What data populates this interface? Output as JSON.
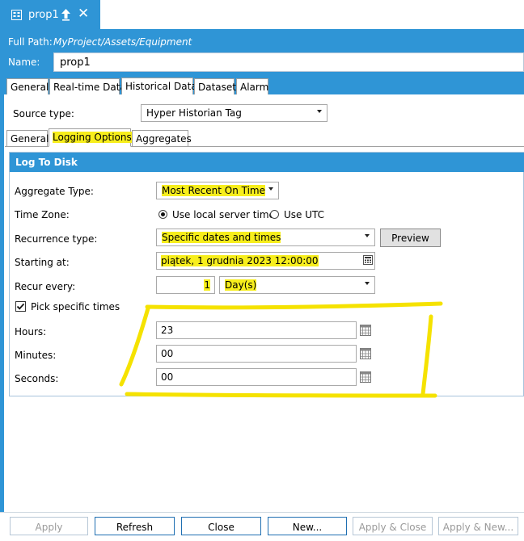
{
  "tab": {
    "title": "prop1"
  },
  "header": {
    "full_path_label": "Full Path:",
    "full_path_value": "MyProject/Assets/Equipment",
    "name_label": "Name:",
    "name_value": "prop1"
  },
  "main_tabs": [
    "General",
    "Real-time Data",
    "Historical Data",
    "Dataset",
    "Alarm"
  ],
  "source_type": {
    "label": "Source type:",
    "value": "Hyper Historian Tag"
  },
  "sub_tabs": [
    "General",
    "Logging Options",
    "Aggregates"
  ],
  "group": {
    "title": "Log To Disk",
    "aggregate_type": {
      "label": "Aggregate Type:",
      "value": "Most Recent On Time"
    },
    "time_zone": {
      "label": "Time Zone:",
      "option_local": "Use local server time",
      "option_utc": "Use UTC",
      "selected": "local"
    },
    "recurrence": {
      "label": "Recurrence type:",
      "value": "Specific dates and times",
      "preview_label": "Preview"
    },
    "starting_at": {
      "label": "Starting at:",
      "value": "piątek, 1 grudnia 2023 12:00:00"
    },
    "recur_every": {
      "label": "Recur every:",
      "number": "1",
      "unit": "Day(s)"
    },
    "pick_times": {
      "label": "Pick specific times",
      "checked": true
    },
    "hours": {
      "label": "Hours:",
      "value": "23"
    },
    "minutes": {
      "label": "Minutes:",
      "value": "00"
    },
    "seconds": {
      "label": "Seconds:",
      "value": "00"
    }
  },
  "footer": {
    "apply": "Apply",
    "refresh": "Refresh",
    "close": "Close",
    "new": "New...",
    "apply_close": "Apply & Close",
    "apply_new": "Apply & New..."
  },
  "colors": {
    "accent": "#2f95d6",
    "highlight": "#f7ee1c",
    "annotation": "#f5e200"
  }
}
